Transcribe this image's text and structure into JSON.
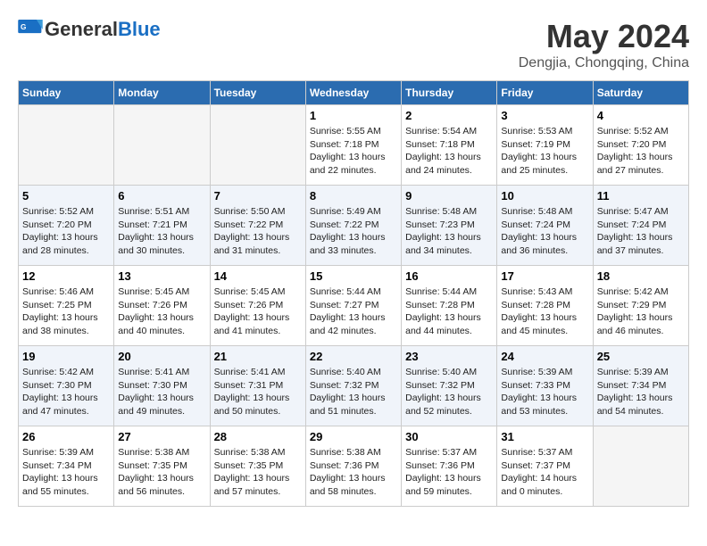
{
  "logo": {
    "general": "General",
    "blue": "Blue"
  },
  "header": {
    "title": "May 2024",
    "subtitle": "Dengjia, Chongqing, China"
  },
  "weekdays": [
    "Sunday",
    "Monday",
    "Tuesday",
    "Wednesday",
    "Thursday",
    "Friday",
    "Saturday"
  ],
  "weeks": [
    [
      {
        "day": "",
        "info": ""
      },
      {
        "day": "",
        "info": ""
      },
      {
        "day": "",
        "info": ""
      },
      {
        "day": "1",
        "info": "Sunrise: 5:55 AM\nSunset: 7:18 PM\nDaylight: 13 hours\nand 22 minutes."
      },
      {
        "day": "2",
        "info": "Sunrise: 5:54 AM\nSunset: 7:18 PM\nDaylight: 13 hours\nand 24 minutes."
      },
      {
        "day": "3",
        "info": "Sunrise: 5:53 AM\nSunset: 7:19 PM\nDaylight: 13 hours\nand 25 minutes."
      },
      {
        "day": "4",
        "info": "Sunrise: 5:52 AM\nSunset: 7:20 PM\nDaylight: 13 hours\nand 27 minutes."
      }
    ],
    [
      {
        "day": "5",
        "info": "Sunrise: 5:52 AM\nSunset: 7:20 PM\nDaylight: 13 hours\nand 28 minutes."
      },
      {
        "day": "6",
        "info": "Sunrise: 5:51 AM\nSunset: 7:21 PM\nDaylight: 13 hours\nand 30 minutes."
      },
      {
        "day": "7",
        "info": "Sunrise: 5:50 AM\nSunset: 7:22 PM\nDaylight: 13 hours\nand 31 minutes."
      },
      {
        "day": "8",
        "info": "Sunrise: 5:49 AM\nSunset: 7:22 PM\nDaylight: 13 hours\nand 33 minutes."
      },
      {
        "day": "9",
        "info": "Sunrise: 5:48 AM\nSunset: 7:23 PM\nDaylight: 13 hours\nand 34 minutes."
      },
      {
        "day": "10",
        "info": "Sunrise: 5:48 AM\nSunset: 7:24 PM\nDaylight: 13 hours\nand 36 minutes."
      },
      {
        "day": "11",
        "info": "Sunrise: 5:47 AM\nSunset: 7:24 PM\nDaylight: 13 hours\nand 37 minutes."
      }
    ],
    [
      {
        "day": "12",
        "info": "Sunrise: 5:46 AM\nSunset: 7:25 PM\nDaylight: 13 hours\nand 38 minutes."
      },
      {
        "day": "13",
        "info": "Sunrise: 5:45 AM\nSunset: 7:26 PM\nDaylight: 13 hours\nand 40 minutes."
      },
      {
        "day": "14",
        "info": "Sunrise: 5:45 AM\nSunset: 7:26 PM\nDaylight: 13 hours\nand 41 minutes."
      },
      {
        "day": "15",
        "info": "Sunrise: 5:44 AM\nSunset: 7:27 PM\nDaylight: 13 hours\nand 42 minutes."
      },
      {
        "day": "16",
        "info": "Sunrise: 5:44 AM\nSunset: 7:28 PM\nDaylight: 13 hours\nand 44 minutes."
      },
      {
        "day": "17",
        "info": "Sunrise: 5:43 AM\nSunset: 7:28 PM\nDaylight: 13 hours\nand 45 minutes."
      },
      {
        "day": "18",
        "info": "Sunrise: 5:42 AM\nSunset: 7:29 PM\nDaylight: 13 hours\nand 46 minutes."
      }
    ],
    [
      {
        "day": "19",
        "info": "Sunrise: 5:42 AM\nSunset: 7:30 PM\nDaylight: 13 hours\nand 47 minutes."
      },
      {
        "day": "20",
        "info": "Sunrise: 5:41 AM\nSunset: 7:30 PM\nDaylight: 13 hours\nand 49 minutes."
      },
      {
        "day": "21",
        "info": "Sunrise: 5:41 AM\nSunset: 7:31 PM\nDaylight: 13 hours\nand 50 minutes."
      },
      {
        "day": "22",
        "info": "Sunrise: 5:40 AM\nSunset: 7:32 PM\nDaylight: 13 hours\nand 51 minutes."
      },
      {
        "day": "23",
        "info": "Sunrise: 5:40 AM\nSunset: 7:32 PM\nDaylight: 13 hours\nand 52 minutes."
      },
      {
        "day": "24",
        "info": "Sunrise: 5:39 AM\nSunset: 7:33 PM\nDaylight: 13 hours\nand 53 minutes."
      },
      {
        "day": "25",
        "info": "Sunrise: 5:39 AM\nSunset: 7:34 PM\nDaylight: 13 hours\nand 54 minutes."
      }
    ],
    [
      {
        "day": "26",
        "info": "Sunrise: 5:39 AM\nSunset: 7:34 PM\nDaylight: 13 hours\nand 55 minutes."
      },
      {
        "day": "27",
        "info": "Sunrise: 5:38 AM\nSunset: 7:35 PM\nDaylight: 13 hours\nand 56 minutes."
      },
      {
        "day": "28",
        "info": "Sunrise: 5:38 AM\nSunset: 7:35 PM\nDaylight: 13 hours\nand 57 minutes."
      },
      {
        "day": "29",
        "info": "Sunrise: 5:38 AM\nSunset: 7:36 PM\nDaylight: 13 hours\nand 58 minutes."
      },
      {
        "day": "30",
        "info": "Sunrise: 5:37 AM\nSunset: 7:36 PM\nDaylight: 13 hours\nand 59 minutes."
      },
      {
        "day": "31",
        "info": "Sunrise: 5:37 AM\nSunset: 7:37 PM\nDaylight: 14 hours\nand 0 minutes."
      },
      {
        "day": "",
        "info": ""
      }
    ]
  ]
}
